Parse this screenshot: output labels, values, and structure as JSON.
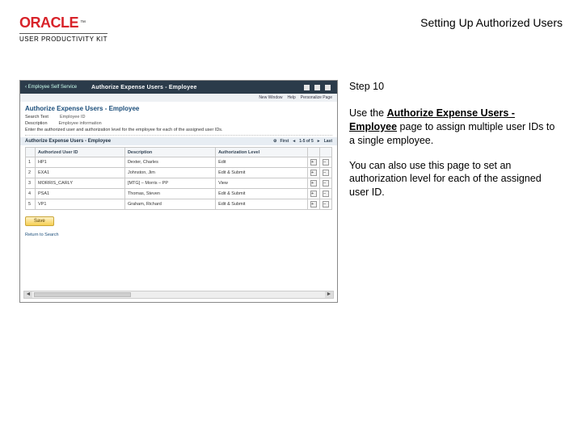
{
  "header": {
    "brand": "ORACLE",
    "tm": "™",
    "subbrand": "USER PRODUCTIVITY KIT",
    "title": "Setting Up Authorized Users"
  },
  "side": {
    "step": "Step 10",
    "p1a": "Use the ",
    "p1b": "Authorize Expense Users - Employee",
    "p1c": " page to assign multiple user IDs to a single employee.",
    "p2": "You can also use this page to set an authorization level for each of the assigned user ID."
  },
  "shot": {
    "backlink": "‹  Employee Self Service",
    "barTitle": "Authorize Expense Users - Employee",
    "subright1": "New Window",
    "subright2": "Help",
    "subright3": "Personalize Page",
    "secTitle": "Authorize Expense Users - Employee",
    "row1k": "Search Text",
    "row1v": "Employee ID",
    "row2k": "Description",
    "row2v": "Employee information",
    "row3": "Enter the authorized user and authorization level for the employee for each of the assigned user IDs.",
    "subhead": "Authorize Expense Users - Employee",
    "subheadIcon": "⚙",
    "pagerFirst": "First",
    "pagerRange": "1-5 of 5",
    "pagerLast": "Last",
    "colAuthUser": "Authorized User ID",
    "colDesc": "Description",
    "colLevel": "Authorization Level",
    "rows": [
      {
        "n": "1",
        "user": "HP1",
        "desc": "Dexter, Charles",
        "level": "Edit"
      },
      {
        "n": "2",
        "user": "EXA1",
        "desc": "Johnston, Jim",
        "level": "Edit & Submit"
      },
      {
        "n": "3",
        "user": "MORRIS_CARLY",
        "desc": "[MTG] – Morris – PP",
        "level": "View"
      },
      {
        "n": "4",
        "user": "PSA1",
        "desc": "Thomas, Steven",
        "level": "Edit & Submit"
      },
      {
        "n": "5",
        "user": "VP1",
        "desc": "Graham, Richard",
        "level": "Edit & Submit"
      }
    ],
    "save": "Save",
    "returnLink": "Return to Search"
  }
}
